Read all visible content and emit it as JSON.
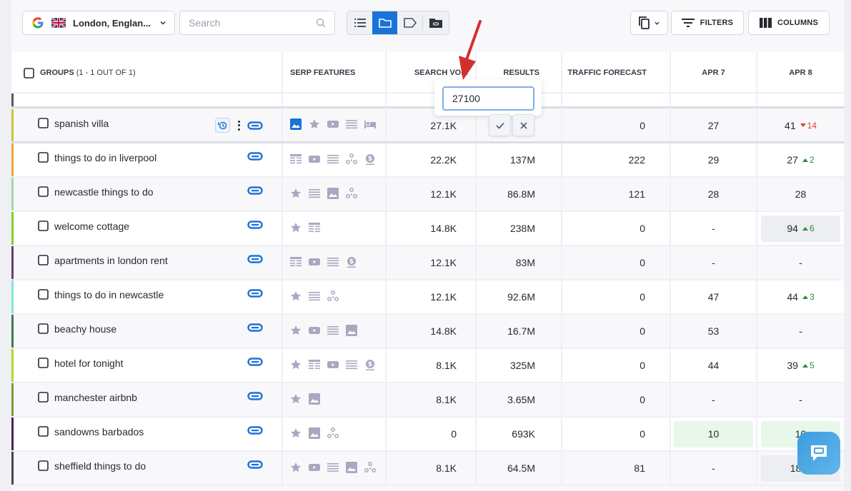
{
  "toolbar": {
    "location": "London, Englan...",
    "search_placeholder": "Search",
    "filters_label": "FILTERS",
    "columns_label": "COLUMNS",
    "view_modes": [
      "list",
      "folders",
      "tags",
      "linked-folders"
    ],
    "active_view": "folders"
  },
  "table": {
    "headers": {
      "groups_label": "GROUPS",
      "groups_sub": "(1 - 1 OUT OF 1)",
      "serp": "SERP FEATURES",
      "volume": "SEARCH VOL.",
      "results": "RESULTS",
      "traffic": "TRAFFIC FORECAST",
      "date1": "APR 7",
      "date2": "APR 8"
    },
    "rows": [
      {
        "keyword": "spanish villa",
        "color": "#c9c538",
        "serp": [
          "image-active",
          "star",
          "video",
          "list",
          "hotel"
        ],
        "volume": "27.1K",
        "results": "",
        "traffic": "0",
        "d1": "27",
        "d2": "41",
        "d2_change": "14",
        "d2_dir": "down",
        "d1_bg": "",
        "d2_bg": "",
        "has_history": true
      },
      {
        "keyword": "things to do in liverpool",
        "color": "#f0a830",
        "serp": [
          "table",
          "video",
          "list",
          "network",
          "dollar"
        ],
        "volume": "22.2K",
        "results": "137M",
        "traffic": "222",
        "d1": "29",
        "d2": "27",
        "d2_change": "2",
        "d2_dir": "up",
        "d1_bg": "",
        "d2_bg": ""
      },
      {
        "keyword": "newcastle things to do",
        "color": "#a0d8a8",
        "serp": [
          "star",
          "list",
          "image",
          "network"
        ],
        "volume": "12.1K",
        "results": "86.8M",
        "traffic": "121",
        "d1": "28",
        "d2": "28",
        "d2_change": "",
        "d2_dir": "",
        "d1_bg": "",
        "d2_bg": ""
      },
      {
        "keyword": "welcome cottage",
        "color": "#7ed321",
        "serp": [
          "star",
          "table"
        ],
        "volume": "14.8K",
        "results": "238M",
        "traffic": "0",
        "d1": "-",
        "d2": "94",
        "d2_change": "6",
        "d2_dir": "up",
        "d1_bg": "",
        "d2_bg": "grey"
      },
      {
        "keyword": "apartments in london rent",
        "color": "#6a3c6e",
        "serp": [
          "table",
          "video",
          "list",
          "dollar"
        ],
        "volume": "12.1K",
        "results": "83M",
        "traffic": "0",
        "d1": "-",
        "d2": "-",
        "d2_change": "",
        "d2_dir": "",
        "d1_bg": "",
        "d2_bg": ""
      },
      {
        "keyword": "things to do in newcastle",
        "color": "#7fe8d0",
        "serp": [
          "star",
          "list",
          "network"
        ],
        "volume": "12.1K",
        "results": "92.6M",
        "traffic": "0",
        "d1": "47",
        "d2": "44",
        "d2_change": "3",
        "d2_dir": "up",
        "d1_bg": "",
        "d2_bg": ""
      },
      {
        "keyword": "beachy house",
        "color": "#3d7a4a",
        "serp": [
          "star",
          "video",
          "list",
          "image"
        ],
        "volume": "14.8K",
        "results": "16.7M",
        "traffic": "0",
        "d1": "53",
        "d2": "-",
        "d2_change": "",
        "d2_dir": "",
        "d1_bg": "",
        "d2_bg": ""
      },
      {
        "keyword": "hotel for tonight",
        "color": "#b5d633",
        "serp": [
          "star",
          "table",
          "video",
          "list",
          "dollar"
        ],
        "volume": "8.1K",
        "results": "325M",
        "traffic": "0",
        "d1": "44",
        "d2": "39",
        "d2_change": "5",
        "d2_dir": "up",
        "d1_bg": "",
        "d2_bg": ""
      },
      {
        "keyword": "manchester airbnb",
        "color": "#7a9a3a",
        "serp": [
          "star",
          "image"
        ],
        "volume": "8.1K",
        "results": "3.65M",
        "traffic": "0",
        "d1": "-",
        "d2": "-",
        "d2_change": "",
        "d2_dir": "",
        "d1_bg": "",
        "d2_bg": ""
      },
      {
        "keyword": "sandowns barbados",
        "color": "#4a2358",
        "serp": [
          "star",
          "image",
          "network"
        ],
        "volume": "0",
        "results": "693K",
        "traffic": "0",
        "d1": "10",
        "d2": "10",
        "d2_change": "",
        "d2_dir": "",
        "d1_bg": "green",
        "d2_bg": "green"
      },
      {
        "keyword": "sheffield things to do",
        "color": "#4a4548",
        "serp": [
          "star",
          "video",
          "list",
          "image",
          "network"
        ],
        "volume": "8.1K",
        "results": "64.5M",
        "traffic": "81",
        "d1": "-",
        "d2": "18",
        "d2_change": "",
        "d2_dir": "up",
        "d1_bg": "",
        "d2_bg": "grey"
      }
    ]
  },
  "editor": {
    "value": "27100"
  },
  "colors": {
    "accent": "#1a73d9",
    "up": "#2d8a45",
    "down": "#e53935"
  }
}
